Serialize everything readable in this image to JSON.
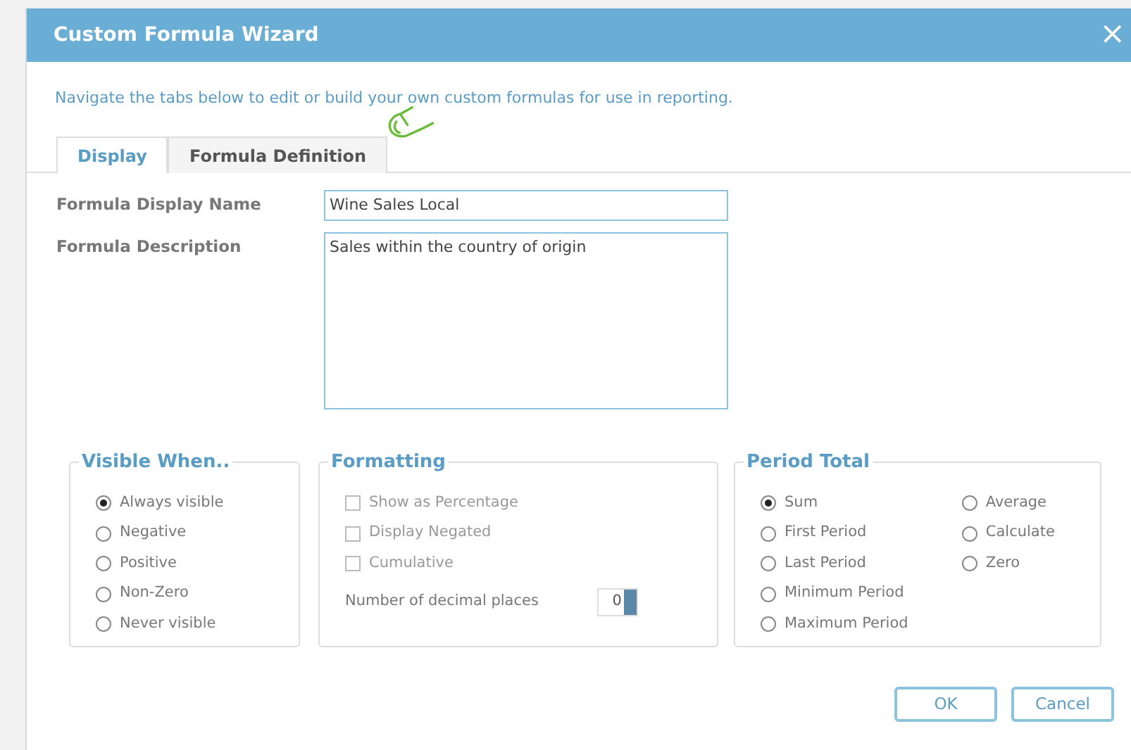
{
  "window": {
    "title": "Custom Formula Wizard",
    "close": "×"
  },
  "instruction": "Navigate the tabs below to edit or build your own custom formulas for use in reporting.",
  "tabs": [
    {
      "label": "Display",
      "selected": true
    },
    {
      "label": "Formula Definition",
      "selected": false
    }
  ],
  "fields": [
    {
      "label": "Formula Display Name",
      "value": "Wine Sales Local",
      "kind": "input"
    },
    {
      "label": "Formula Description",
      "value": "Sales within the country of origin",
      "kind": "textarea"
    }
  ],
  "visible_when": {
    "title": "Visible When..",
    "options": [
      {
        "label": "Always visible",
        "selected": true
      },
      {
        "label": "Negative",
        "selected": false
      },
      {
        "label": "Positive",
        "selected": false
      },
      {
        "label": "Non-Zero",
        "selected": false
      },
      {
        "label": "Never visible",
        "selected": false
      }
    ]
  },
  "formatting": {
    "title": "Formatting",
    "options": [
      {
        "label": "Show as Percentage",
        "checked": false,
        "disabled": true
      },
      {
        "label": "Display Negated",
        "checked": false,
        "disabled": true
      },
      {
        "label": "Cumulative",
        "checked": false,
        "disabled": true
      }
    ],
    "decimal_label": "Number of decimal places",
    "decimal_value": "0"
  },
  "period_total": {
    "title": "Period Total",
    "options": [
      {
        "label": "Sum",
        "selected": true
      },
      {
        "label": "First Period",
        "selected": false
      },
      {
        "label": "Last Period",
        "selected": false
      },
      {
        "label": "Minimum Period",
        "selected": false
      },
      {
        "label": "Maximum Period",
        "selected": false
      },
      {
        "label": "Average",
        "selected": false
      },
      {
        "label": "Calculate",
        "selected": false
      },
      {
        "label": "Zero",
        "selected": false
      }
    ]
  },
  "buttons": [
    "OK",
    "Cancel"
  ]
}
